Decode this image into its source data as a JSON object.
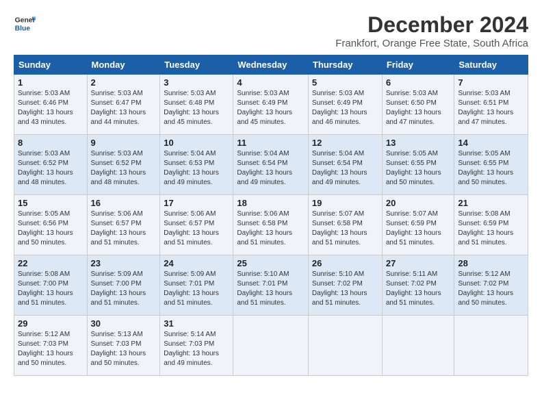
{
  "logo": {
    "line1": "General",
    "line2": "Blue"
  },
  "title": "December 2024",
  "subtitle": "Frankfort, Orange Free State, South Africa",
  "days_header": [
    "Sunday",
    "Monday",
    "Tuesday",
    "Wednesday",
    "Thursday",
    "Friday",
    "Saturday"
  ],
  "weeks": [
    [
      {
        "day": "1",
        "lines": [
          "Sunrise: 5:03 AM",
          "Sunset: 6:46 PM",
          "Daylight: 13 hours",
          "and 43 minutes."
        ]
      },
      {
        "day": "2",
        "lines": [
          "Sunrise: 5:03 AM",
          "Sunset: 6:47 PM",
          "Daylight: 13 hours",
          "and 44 minutes."
        ]
      },
      {
        "day": "3",
        "lines": [
          "Sunrise: 5:03 AM",
          "Sunset: 6:48 PM",
          "Daylight: 13 hours",
          "and 45 minutes."
        ]
      },
      {
        "day": "4",
        "lines": [
          "Sunrise: 5:03 AM",
          "Sunset: 6:49 PM",
          "Daylight: 13 hours",
          "and 45 minutes."
        ]
      },
      {
        "day": "5",
        "lines": [
          "Sunrise: 5:03 AM",
          "Sunset: 6:49 PM",
          "Daylight: 13 hours",
          "and 46 minutes."
        ]
      },
      {
        "day": "6",
        "lines": [
          "Sunrise: 5:03 AM",
          "Sunset: 6:50 PM",
          "Daylight: 13 hours",
          "and 47 minutes."
        ]
      },
      {
        "day": "7",
        "lines": [
          "Sunrise: 5:03 AM",
          "Sunset: 6:51 PM",
          "Daylight: 13 hours",
          "and 47 minutes."
        ]
      }
    ],
    [
      {
        "day": "8",
        "lines": [
          "Sunrise: 5:03 AM",
          "Sunset: 6:52 PM",
          "Daylight: 13 hours",
          "and 48 minutes."
        ]
      },
      {
        "day": "9",
        "lines": [
          "Sunrise: 5:03 AM",
          "Sunset: 6:52 PM",
          "Daylight: 13 hours",
          "and 48 minutes."
        ]
      },
      {
        "day": "10",
        "lines": [
          "Sunrise: 5:04 AM",
          "Sunset: 6:53 PM",
          "Daylight: 13 hours",
          "and 49 minutes."
        ]
      },
      {
        "day": "11",
        "lines": [
          "Sunrise: 5:04 AM",
          "Sunset: 6:54 PM",
          "Daylight: 13 hours",
          "and 49 minutes."
        ]
      },
      {
        "day": "12",
        "lines": [
          "Sunrise: 5:04 AM",
          "Sunset: 6:54 PM",
          "Daylight: 13 hours",
          "and 49 minutes."
        ]
      },
      {
        "day": "13",
        "lines": [
          "Sunrise: 5:05 AM",
          "Sunset: 6:55 PM",
          "Daylight: 13 hours",
          "and 50 minutes."
        ]
      },
      {
        "day": "14",
        "lines": [
          "Sunrise: 5:05 AM",
          "Sunset: 6:55 PM",
          "Daylight: 13 hours",
          "and 50 minutes."
        ]
      }
    ],
    [
      {
        "day": "15",
        "lines": [
          "Sunrise: 5:05 AM",
          "Sunset: 6:56 PM",
          "Daylight: 13 hours",
          "and 50 minutes."
        ]
      },
      {
        "day": "16",
        "lines": [
          "Sunrise: 5:06 AM",
          "Sunset: 6:57 PM",
          "Daylight: 13 hours",
          "and 51 minutes."
        ]
      },
      {
        "day": "17",
        "lines": [
          "Sunrise: 5:06 AM",
          "Sunset: 6:57 PM",
          "Daylight: 13 hours",
          "and 51 minutes."
        ]
      },
      {
        "day": "18",
        "lines": [
          "Sunrise: 5:06 AM",
          "Sunset: 6:58 PM",
          "Daylight: 13 hours",
          "and 51 minutes."
        ]
      },
      {
        "day": "19",
        "lines": [
          "Sunrise: 5:07 AM",
          "Sunset: 6:58 PM",
          "Daylight: 13 hours",
          "and 51 minutes."
        ]
      },
      {
        "day": "20",
        "lines": [
          "Sunrise: 5:07 AM",
          "Sunset: 6:59 PM",
          "Daylight: 13 hours",
          "and 51 minutes."
        ]
      },
      {
        "day": "21",
        "lines": [
          "Sunrise: 5:08 AM",
          "Sunset: 6:59 PM",
          "Daylight: 13 hours",
          "and 51 minutes."
        ]
      }
    ],
    [
      {
        "day": "22",
        "lines": [
          "Sunrise: 5:08 AM",
          "Sunset: 7:00 PM",
          "Daylight: 13 hours",
          "and 51 minutes."
        ]
      },
      {
        "day": "23",
        "lines": [
          "Sunrise: 5:09 AM",
          "Sunset: 7:00 PM",
          "Daylight: 13 hours",
          "and 51 minutes."
        ]
      },
      {
        "day": "24",
        "lines": [
          "Sunrise: 5:09 AM",
          "Sunset: 7:01 PM",
          "Daylight: 13 hours",
          "and 51 minutes."
        ]
      },
      {
        "day": "25",
        "lines": [
          "Sunrise: 5:10 AM",
          "Sunset: 7:01 PM",
          "Daylight: 13 hours",
          "and 51 minutes."
        ]
      },
      {
        "day": "26",
        "lines": [
          "Sunrise: 5:10 AM",
          "Sunset: 7:02 PM",
          "Daylight: 13 hours",
          "and 51 minutes."
        ]
      },
      {
        "day": "27",
        "lines": [
          "Sunrise: 5:11 AM",
          "Sunset: 7:02 PM",
          "Daylight: 13 hours",
          "and 51 minutes."
        ]
      },
      {
        "day": "28",
        "lines": [
          "Sunrise: 5:12 AM",
          "Sunset: 7:02 PM",
          "Daylight: 13 hours",
          "and 50 minutes."
        ]
      }
    ],
    [
      {
        "day": "29",
        "lines": [
          "Sunrise: 5:12 AM",
          "Sunset: 7:03 PM",
          "Daylight: 13 hours",
          "and 50 minutes."
        ]
      },
      {
        "day": "30",
        "lines": [
          "Sunrise: 5:13 AM",
          "Sunset: 7:03 PM",
          "Daylight: 13 hours",
          "and 50 minutes."
        ]
      },
      {
        "day": "31",
        "lines": [
          "Sunrise: 5:14 AM",
          "Sunset: 7:03 PM",
          "Daylight: 13 hours",
          "and 49 minutes."
        ]
      },
      null,
      null,
      null,
      null
    ]
  ]
}
